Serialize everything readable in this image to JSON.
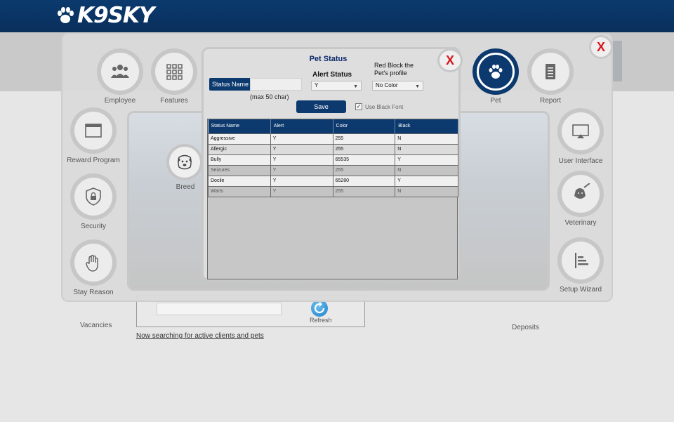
{
  "app": {
    "logo_text": "K9SKY"
  },
  "background": {
    "vacancies_label": "Vacancies",
    "deposits_label": "Deposits",
    "refresh_label": "Refresh",
    "search_status": "Now searching for active clients and pets"
  },
  "panel": {
    "close_label": "X",
    "nav": {
      "employee": "Employee",
      "features": "Features",
      "pet": "Pet",
      "report": "Report",
      "reward_program": "Reward Program",
      "security": "Security",
      "stay_reason": "Stay Reason",
      "user_interface": "User Interface",
      "veterinary": "Veterinary",
      "setup_wizard": "Setup Wizard",
      "breed": "Breed"
    },
    "active_item": "Pet"
  },
  "dialog": {
    "title": "Pet Status",
    "close_label": "X",
    "status_name_label": "Status Name",
    "status_name_value": "",
    "max_hint": "(max 50 char)",
    "alert_status_title": "Alert Status",
    "alert_status_value": "Y",
    "red_block_title": "Red Block the Pet's profile",
    "color_value": "No Color",
    "save_label": "Save",
    "use_black_font_label": "Use Black Font",
    "use_black_font_checked": true,
    "table": {
      "columns": [
        "Status Name",
        "Alert",
        "Color",
        "Black"
      ],
      "rows": [
        [
          "Aggressive",
          "Y",
          "255",
          "N"
        ],
        [
          "Allergic",
          "Y",
          "255",
          "N"
        ],
        [
          "Bully",
          "Y",
          "65535",
          "Y"
        ],
        [
          "Seizures",
          "Y",
          "255",
          "N"
        ],
        [
          "Docile",
          "Y",
          "65280",
          "Y"
        ],
        [
          "Warts",
          "Y",
          "255",
          "N"
        ]
      ]
    }
  },
  "colors": {
    "header_navy": "#0b3a6e",
    "accent_red": "#d8161c",
    "panel_gray": "#dadada"
  },
  "icons": {
    "logo": "paw-logo-icon",
    "employee": "people-icon",
    "features": "grid-icon",
    "pet": "paw-icon",
    "report": "document-icon",
    "reward_program": "window-icon",
    "security": "shield-lock-icon",
    "stay_reason": "hand-icon",
    "user_interface": "monitor-icon",
    "veterinary": "dog-syringe-icon",
    "setup_wizard": "bars-icon",
    "breed": "dog-face-icon",
    "refresh": "refresh-icon"
  }
}
